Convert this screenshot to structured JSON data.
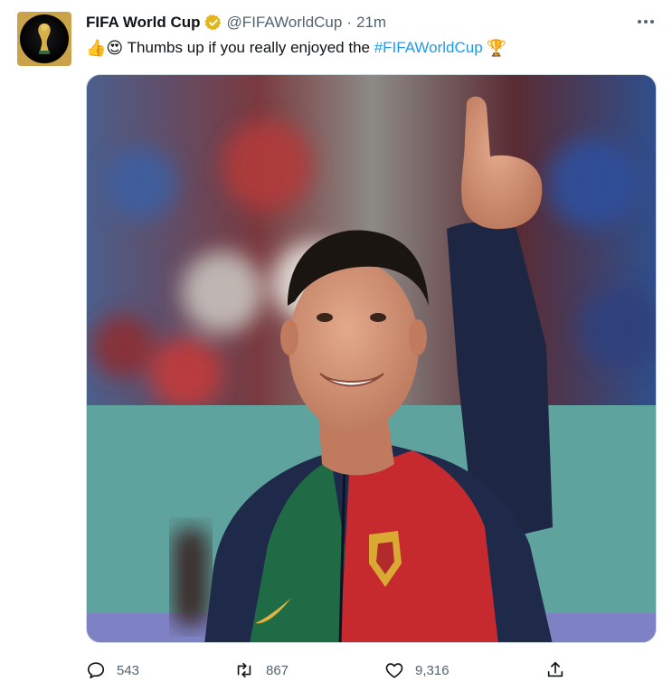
{
  "tweet": {
    "display_name": "FIFA World Cup",
    "handle": "@FIFAWorldCup",
    "separator": "·",
    "time": "21m",
    "text_emoji": "👍😍",
    "text_body": " Thumbs up if you really enjoyed the ",
    "hashtag": "#FIFAWorldCup",
    "trophy_emoji": "🏆"
  },
  "icons": {
    "avatar": "world-cup-trophy-icon",
    "verified": "verified-badge-icon",
    "more": "more-options-icon",
    "reply": "reply-icon",
    "retweet": "retweet-icon",
    "like": "like-icon",
    "share": "share-icon"
  },
  "actions": {
    "reply_count": "543",
    "retweet_count": "867",
    "like_count": "9,316"
  },
  "colors": {
    "accent": "#1d9bf0",
    "verified_gold": "#e2b719",
    "muted": "#536471"
  }
}
